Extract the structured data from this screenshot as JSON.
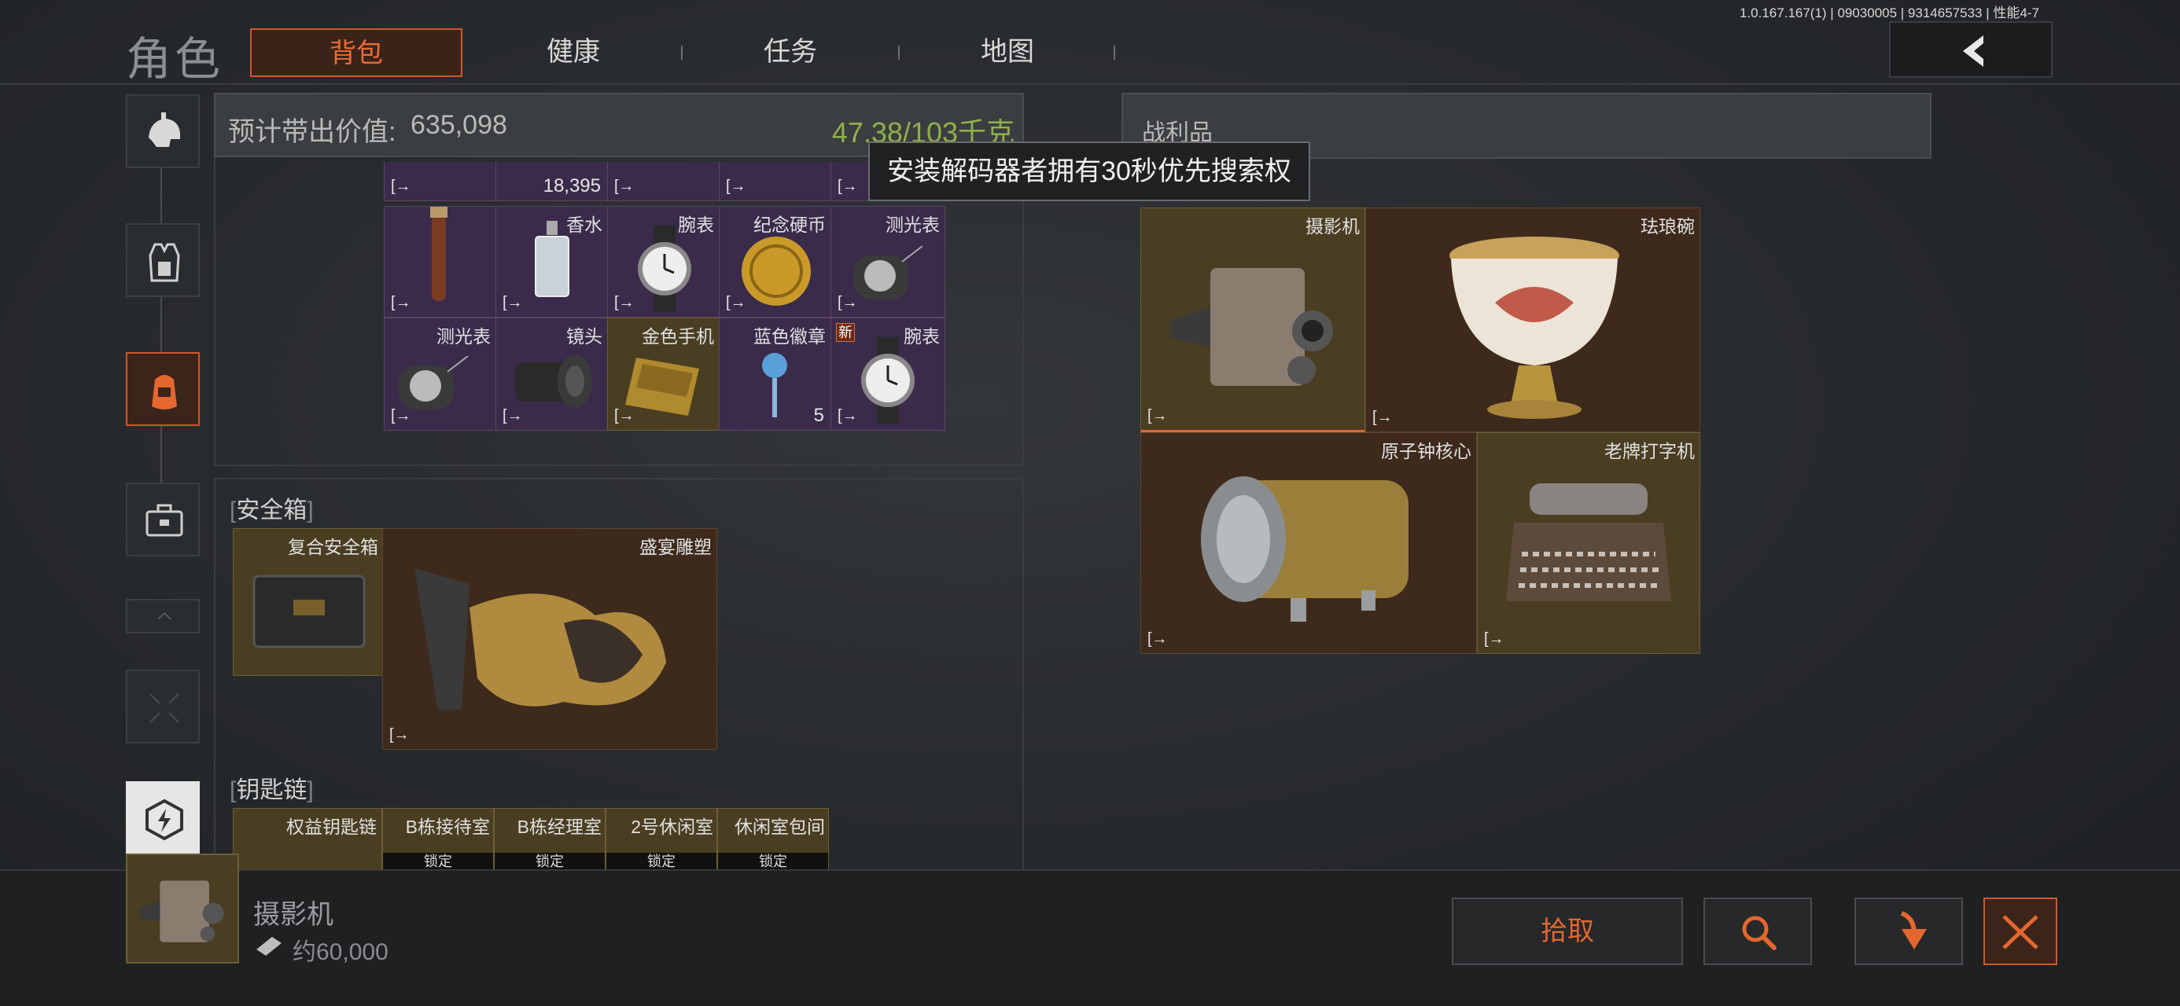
{
  "header": {
    "title": "角色",
    "tabs": [
      {
        "label": "背包",
        "active": true
      },
      {
        "label": "健康",
        "active": false
      },
      {
        "label": "任务",
        "active": false
      },
      {
        "label": "地图",
        "active": false
      }
    ],
    "version": "1.0.167.167(1) | 09030005 | 9314657533 | 性能4-7"
  },
  "sidebar": {
    "items": [
      {
        "icon": "helmet-icon",
        "active": false
      },
      {
        "icon": "armor-vest-icon",
        "active": false
      },
      {
        "icon": "backpack-icon",
        "active": true
      },
      {
        "icon": "safe-case-icon",
        "active": false
      },
      {
        "icon": "slot-collapsed-icon",
        "active": false
      },
      {
        "icon": "empty-slot-icon",
        "active": false
      },
      {
        "icon": "keychain-icon",
        "active": false
      }
    ]
  },
  "backpack": {
    "value_label": "预计带出价值:",
    "value": "635,098",
    "weight": "47.38/103千克",
    "top_row_count": "18,395",
    "items": [
      {
        "name": "",
        "color": "purple",
        "icon": "magnifier-icon"
      },
      {
        "name": "香水",
        "color": "purple",
        "icon": "perfume-bottle-icon"
      },
      {
        "name": "腕表",
        "color": "purple",
        "icon": "wristwatch-icon"
      },
      {
        "name": "纪念硬币",
        "color": "purple",
        "icon": "gold-coin-icon"
      },
      {
        "name": "测光表",
        "color": "purple",
        "icon": "light-meter-icon"
      },
      {
        "name": "测光表",
        "color": "purple",
        "icon": "light-meter-icon"
      },
      {
        "name": "镜头",
        "color": "purple",
        "icon": "camera-lens-icon"
      },
      {
        "name": "金色手机",
        "color": "gold",
        "icon": "gold-phone-icon"
      },
      {
        "name": "蓝色徽章",
        "color": "purple",
        "icon": "blue-badge-icon",
        "count": "5"
      },
      {
        "name": "腕表",
        "color": "purple",
        "icon": "wristwatch-icon",
        "new_badge": "新"
      }
    ]
  },
  "safe_box": {
    "title": "安全箱",
    "container": "复合安全箱",
    "item": "盛宴雕塑"
  },
  "keychain": {
    "title": "钥匙链",
    "items": [
      {
        "name": "权益钥匙链",
        "status": ""
      },
      {
        "name": "B栋接待室",
        "status": "锁定"
      },
      {
        "name": "B栋经理室",
        "status": "锁定"
      },
      {
        "name": "2号休闲室",
        "status": "锁定"
      },
      {
        "name": "休闲室包间",
        "status": "锁定"
      }
    ]
  },
  "tooltip": {
    "text": "安装解码器者拥有30秒优先搜索权"
  },
  "loot": {
    "title": "战利品",
    "items": [
      {
        "name": "摄影机",
        "color": "gold",
        "icon": "movie-camera-icon"
      },
      {
        "name": "珐琅碗",
        "color": "brown",
        "icon": "enamel-bowl-icon"
      },
      {
        "name": "原子钟核心",
        "color": "brown",
        "icon": "atomic-clock-core-icon"
      },
      {
        "name": "老牌打字机",
        "color": "gold",
        "icon": "typewriter-icon"
      }
    ]
  },
  "selected": {
    "name": "摄影机",
    "value": "约60,000"
  },
  "actions": {
    "pickup_label": "拾取"
  },
  "colors": {
    "accent": "#e4672f",
    "purple_rarity": "#3a2b4b",
    "gold_rarity": "#4a3e22",
    "brown_rarity": "#3d2a1c",
    "weight_green": "#8fb04a"
  }
}
